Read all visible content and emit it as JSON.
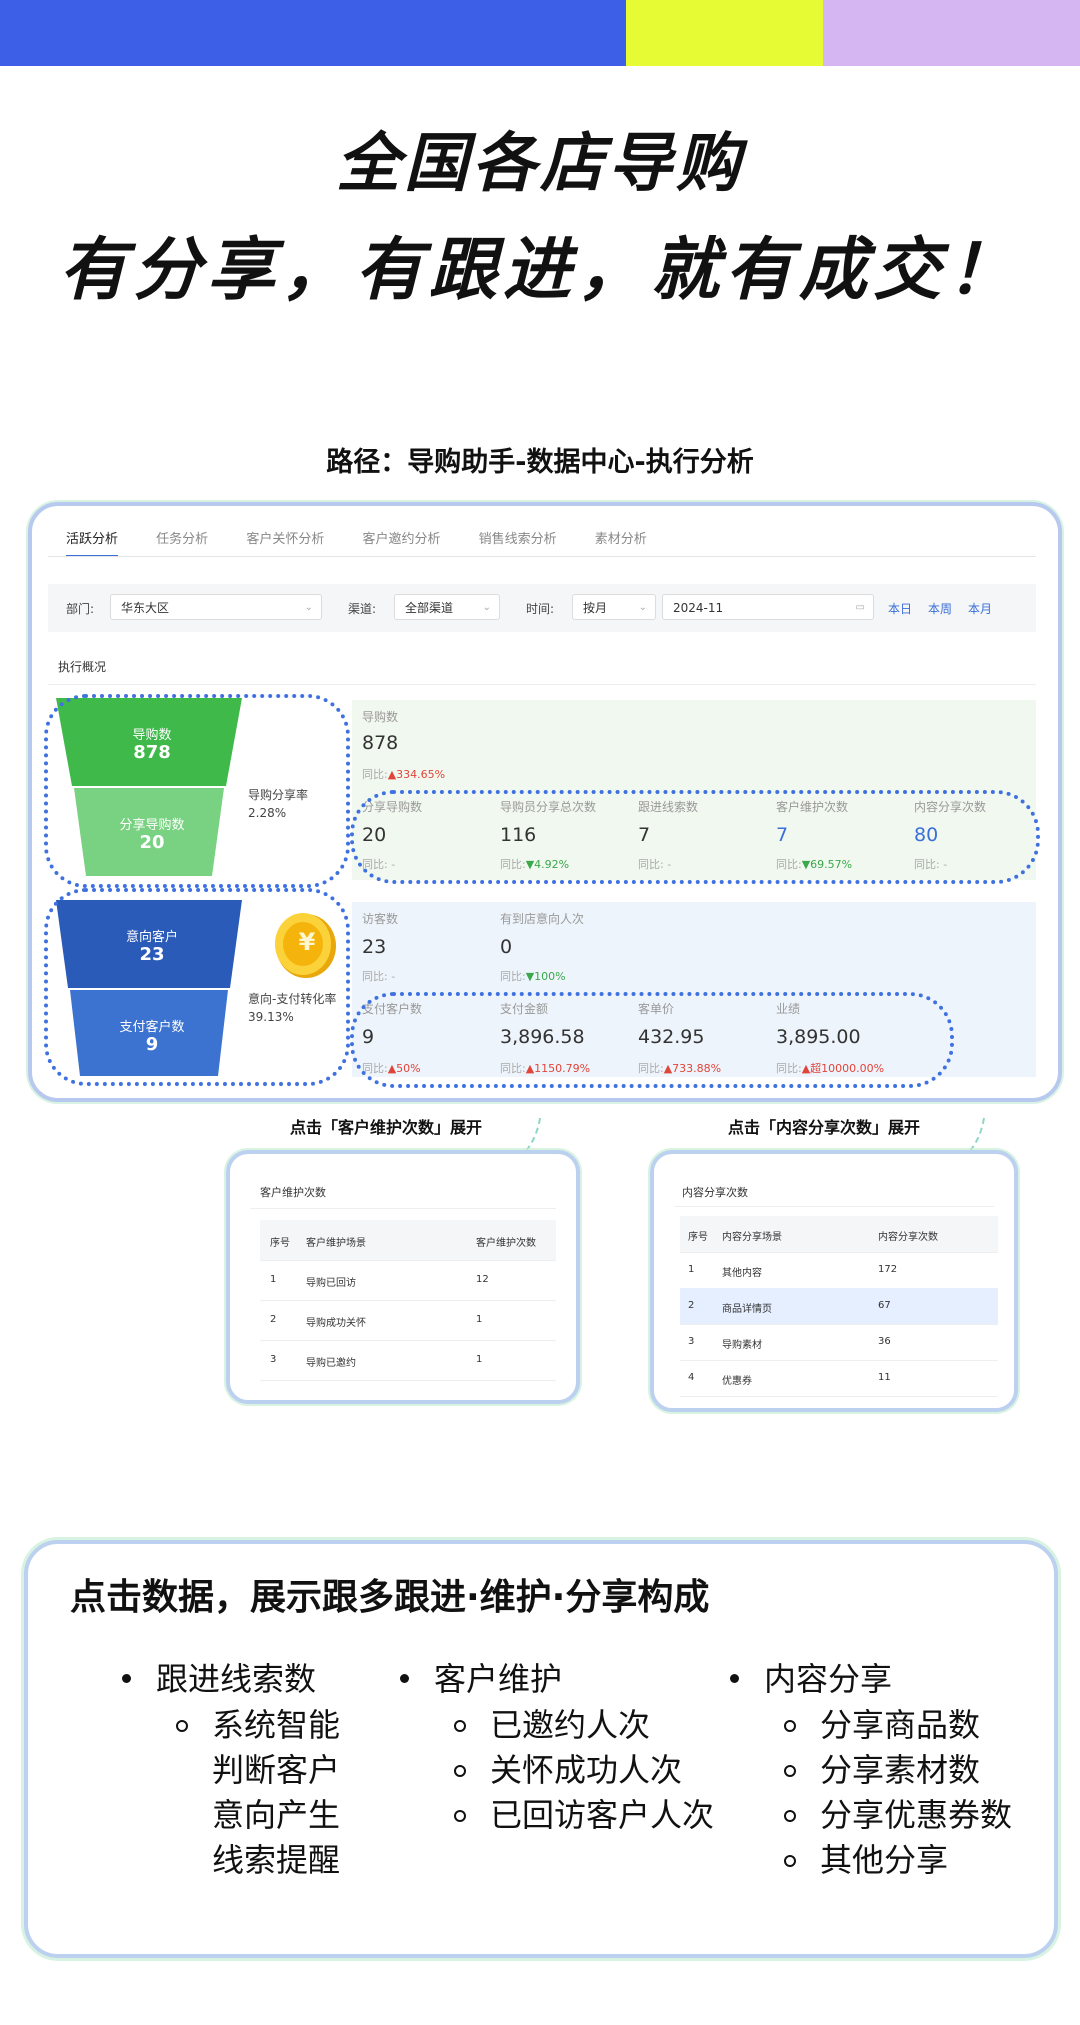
{
  "colors": {
    "bar_blue": "#3d5ee6",
    "bar_yellow": "#e6fb33",
    "bar_purple": "#d5b6f3",
    "accent": "#3b6fd8",
    "green_funnel": "#3fb94a",
    "blue_funnel": "#2a5bb8",
    "dotted": "#3f72e0",
    "frame": "#b7c9ee"
  },
  "headline": {
    "line1": "全国各店导购",
    "line2": "有分享，有跟进，就有成交！"
  },
  "path_label": "路径：导购助手-数据中心-执行分析",
  "tabs": [
    "活跃分析",
    "任务分析",
    "客户关怀分析",
    "客户邀约分析",
    "销售线索分析",
    "素材分析"
  ],
  "filters": {
    "dept_label": "部门:",
    "dept_value": "华东大区",
    "channel_label": "渠道:",
    "channel_value": "全部渠道",
    "time_label": "时间:",
    "period_value": "按月",
    "date_value": "2024-11",
    "quick": [
      "本日",
      "本周",
      "本月"
    ]
  },
  "section_title": "执行概况",
  "funnel1": {
    "top_label": "导购数",
    "top_value": "878",
    "bottom_label": "分享导购数",
    "bottom_value": "20",
    "rate_label": "导购分享率",
    "rate_value": "2.28%"
  },
  "funnel2": {
    "top_label": "意向客户",
    "top_value": "23",
    "bottom_label": "支付客户数",
    "bottom_value": "9",
    "rate_label": "意向-支付转化率",
    "rate_value": "39.13%"
  },
  "panel1": {
    "head": {
      "label": "导购数",
      "value": "878",
      "cmp": "同比:",
      "delta": "▲334.65%"
    },
    "metrics": [
      {
        "label": "分享导购数",
        "value": "20",
        "cmp": "同比: -",
        "delta": ""
      },
      {
        "label": "导购员分享总次数",
        "value": "116",
        "cmp": "同比:",
        "delta": "▼4.92%"
      },
      {
        "label": "跟进线索数",
        "value": "7",
        "cmp": "同比: -",
        "delta": ""
      },
      {
        "label": "客户维护次数",
        "value": "7",
        "cmp": "同比:",
        "delta": "▼69.57%"
      },
      {
        "label": "内容分享次数",
        "value": "80",
        "cmp": "同比: -",
        "delta": ""
      }
    ]
  },
  "panel2": {
    "head": [
      {
        "label": "访客数",
        "value": "23",
        "cmp": "同比: -",
        "delta": ""
      },
      {
        "label": "有到店意向人次",
        "value": "0",
        "cmp": "同比:",
        "delta": "▼100%"
      }
    ],
    "metrics": [
      {
        "label": "支付客户数",
        "value": "9",
        "cmp": "同比:",
        "delta": "▲50%"
      },
      {
        "label": "支付金额",
        "value": "3,896.58",
        "cmp": "同比:",
        "delta": "▲1150.79%"
      },
      {
        "label": "客单价",
        "value": "432.95",
        "cmp": "同比:",
        "delta": "▲733.88%"
      },
      {
        "label": "业绩",
        "value": "3,895.00",
        "cmp": "同比:",
        "delta": "▲超10000.00%"
      }
    ]
  },
  "coin_symbol": "¥",
  "caption1": "点击「客户维护次数」展开",
  "caption2": "点击「内容分享次数」展开",
  "popup1": {
    "title": "客户维护次数",
    "headers": [
      "序号",
      "客户维护场景",
      "客户维护次数"
    ],
    "rows": [
      [
        "1",
        "导购已回访",
        "12"
      ],
      [
        "2",
        "导购成功关怀",
        "1"
      ],
      [
        "3",
        "导购已邀约",
        "1"
      ]
    ]
  },
  "popup2": {
    "title": "内容分享次数",
    "headers": [
      "序号",
      "内容分享场景",
      "内容分享次数"
    ],
    "rows": [
      [
        "1",
        "其他内容",
        "172"
      ],
      [
        "2",
        "商品详情页",
        "67"
      ],
      [
        "3",
        "导购素材",
        "36"
      ],
      [
        "4",
        "优惠券",
        "11"
      ]
    ]
  },
  "bottom": {
    "title": "点击数据，展示跟多跟进·维护·分享构成",
    "col1": {
      "head": "跟进线索数",
      "sub": [
        "系统智能",
        "判断客户",
        "意向产生",
        "线索提醒"
      ]
    },
    "col2": {
      "head": "客户维护",
      "sub": [
        "已邀约人次",
        "关怀成功人次",
        "已回访客户人次"
      ]
    },
    "col3": {
      "head": "内容分享",
      "sub": [
        "分享商品数",
        "分享素材数",
        "分享优惠券数",
        "其他分享"
      ]
    }
  }
}
